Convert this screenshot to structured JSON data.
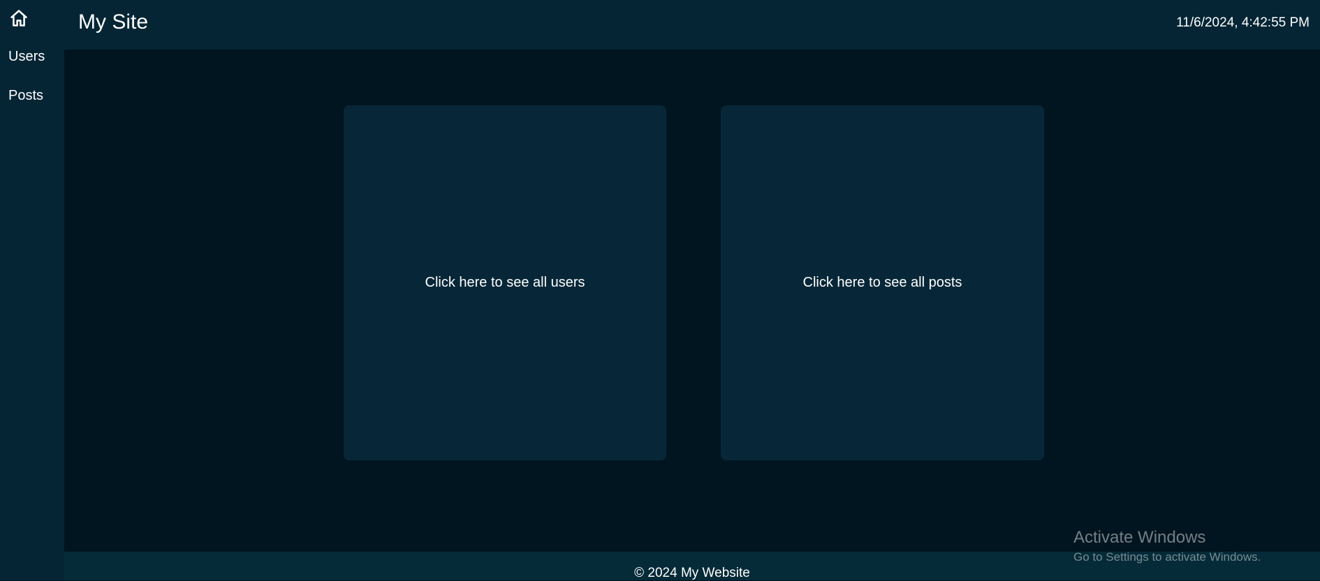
{
  "sidebar": {
    "home_icon": "home-icon",
    "items": [
      {
        "label": "Users"
      },
      {
        "label": "Posts"
      }
    ]
  },
  "header": {
    "title": "My Site",
    "datetime": "11/6/2024, 4:42:55 PM"
  },
  "main": {
    "cards": [
      {
        "label": "Click here to see all users"
      },
      {
        "label": "Click here to see all posts"
      }
    ]
  },
  "footer": {
    "text": "© 2024 My Website"
  },
  "watermark": {
    "title": "Activate Windows",
    "subtitle": "Go to Settings to activate Windows."
  },
  "colors": {
    "background": "#001520",
    "sidebar": "#052535",
    "card": "#072738",
    "footer": "#052a38",
    "text": "#ffffff"
  }
}
